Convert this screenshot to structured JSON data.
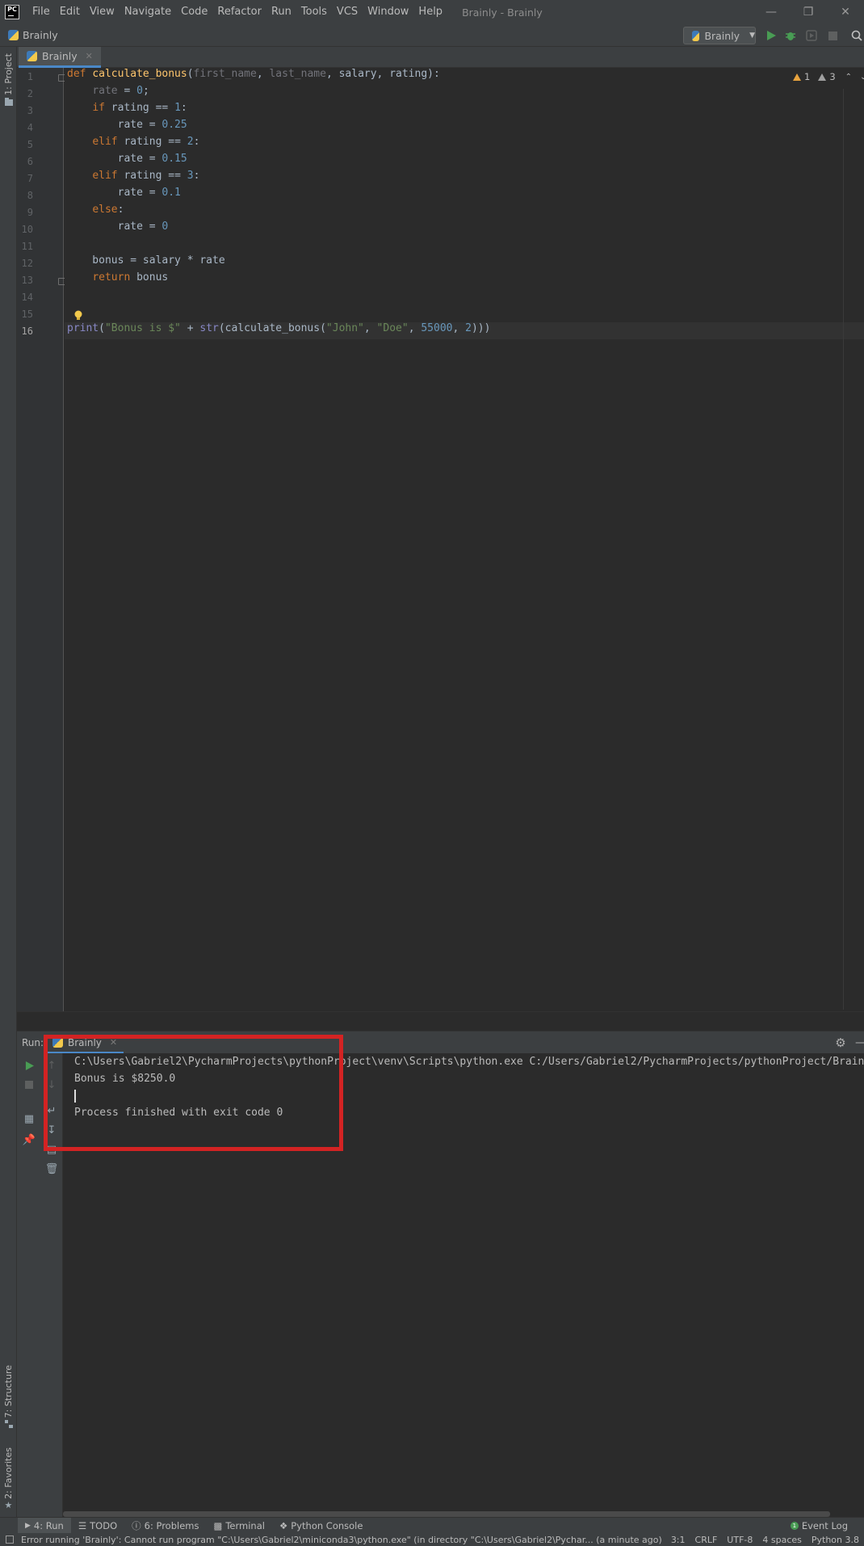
{
  "titlebar": {
    "menu": [
      "File",
      "Edit",
      "View",
      "Navigate",
      "Code",
      "Refactor",
      "Run",
      "Tools",
      "VCS",
      "Window",
      "Help"
    ],
    "window_title": "Brainly - Brainly",
    "logo_text": "PC"
  },
  "navbar": {
    "project_crumb": "Brainly",
    "run_config": "Brainly"
  },
  "left_strip": {
    "project": "1: Project",
    "structure": "7: Structure",
    "favorites": "2: Favorites"
  },
  "editor": {
    "tab_label": "Brainly",
    "active_line": 16,
    "warnings_count": "1",
    "weak_warnings_count": "3",
    "line_numbers": [
      "1",
      "2",
      "3",
      "4",
      "5",
      "6",
      "7",
      "8",
      "9",
      "10",
      "11",
      "12",
      "13",
      "14",
      "15",
      "16"
    ]
  },
  "run_panel": {
    "title": "Run:",
    "tab_label": "Brainly",
    "output": [
      "C:\\Users\\Gabriel2\\PycharmProjects\\pythonProject\\venv\\Scripts\\python.exe C:/Users/Gabriel2/PycharmProjects/pythonProject/Brainly.py",
      "Bonus is $8250.0",
      "",
      "Process finished with exit code 0"
    ]
  },
  "bottom_tabs": {
    "run": "4: Run",
    "todo": "TODO",
    "problems": "6: Problems",
    "terminal": "Terminal",
    "python_console": "Python Console",
    "event_log": "Event Log"
  },
  "statusbar": {
    "message": "Error running 'Brainly': Cannot run program \"C:\\Users\\Gabriel2\\miniconda3\\python.exe\" (in directory \"C:\\Users\\Gabriel2\\Pychar... (a minute ago)",
    "position": "3:1",
    "line_sep": "CRLF",
    "encoding": "UTF-8",
    "indent": "4 spaces",
    "interpreter": "Python 3.8"
  },
  "colors": {
    "keyword": "#cc7832",
    "function": "#ffc66d",
    "number": "#6897bb",
    "string": "#6a8759",
    "highlight_box": "#d32323"
  }
}
